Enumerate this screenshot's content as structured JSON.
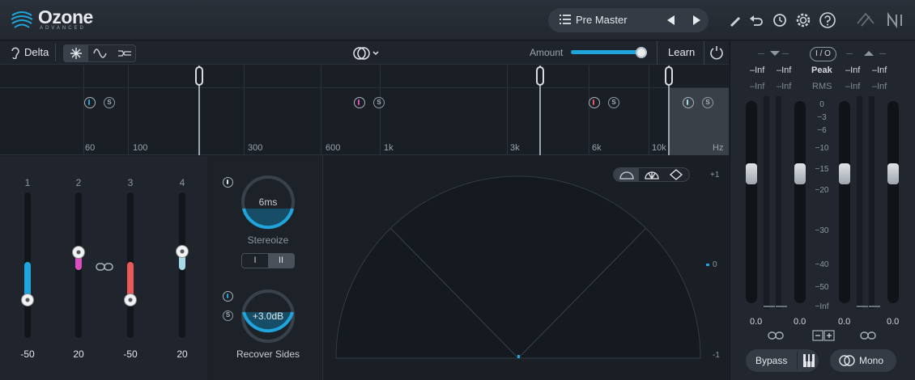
{
  "app": {
    "name": "Ozone",
    "edition": "ADVANCED"
  },
  "preset": {
    "name": "Pre Master"
  },
  "toolbar": {
    "delta_label": "Delta",
    "amount_label": "Amount",
    "amount_value": 0.93,
    "learn_label": "Learn"
  },
  "colors": {
    "accent": "#1fa4dc",
    "band1": "#1fa4dc",
    "band2": "#d94fbf",
    "band3": "#e85a5a",
    "band4": "#a8dbe8"
  },
  "spectrum": {
    "freq_labels": [
      "60",
      "100",
      "300",
      "600",
      "1k",
      "3k",
      "6k",
      "10k",
      "Hz"
    ]
  },
  "widths": {
    "bands": [
      {
        "index": "1",
        "value": "-50"
      },
      {
        "index": "2",
        "value": "20"
      },
      {
        "index": "3",
        "value": "-50"
      },
      {
        "index": "4",
        "value": "20"
      }
    ]
  },
  "stereoize": {
    "value": "6ms",
    "label": "Stereoize",
    "mode_i": "I",
    "mode_ii": "II"
  },
  "recover": {
    "value": "+3.0dB",
    "label": "Recover Sides"
  },
  "scope": {
    "top_label": "+1",
    "mid_label": "0",
    "bottom_label": "-1"
  },
  "meters": {
    "io_label": "I / O",
    "peak_label": "Peak",
    "rms_label": "RMS",
    "in_peak": [
      "–Inf",
      "–Inf"
    ],
    "in_rms": [
      "–Inf",
      "–Inf"
    ],
    "out_peak": [
      "–Inf",
      "–Inf"
    ],
    "out_rms": [
      "–Inf",
      "–Inf"
    ],
    "scale": [
      "0",
      "−3",
      "−6",
      "−10",
      "−15",
      "−20",
      "−30",
      "−40",
      "−50",
      "−Inf"
    ],
    "fader_values": [
      "0.0",
      "0.0",
      "0.0",
      "0.0"
    ],
    "bypass_label": "Bypass",
    "mono_label": "Mono"
  }
}
